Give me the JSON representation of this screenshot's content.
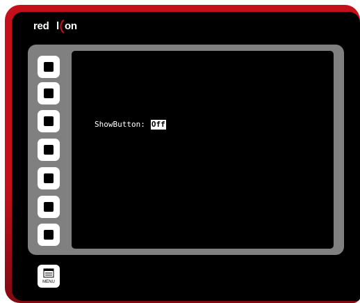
{
  "device": {
    "brand": "red lion",
    "bezel_color": "#c4101a",
    "face_color": "#000000",
    "frame_color": "#808080"
  },
  "soft_keys": [
    {
      "icon": "square-key-icon"
    },
    {
      "icon": "square-key-icon"
    },
    {
      "icon": "square-key-icon"
    },
    {
      "icon": "square-key-icon"
    },
    {
      "icon": "square-key-icon"
    },
    {
      "icon": "square-key-icon"
    },
    {
      "icon": "square-key-icon"
    }
  ],
  "screen": {
    "field_label": "ShowButton:",
    "field_value": "Off"
  },
  "menu_button": {
    "label": "MENU",
    "icon": "menu-icon"
  }
}
